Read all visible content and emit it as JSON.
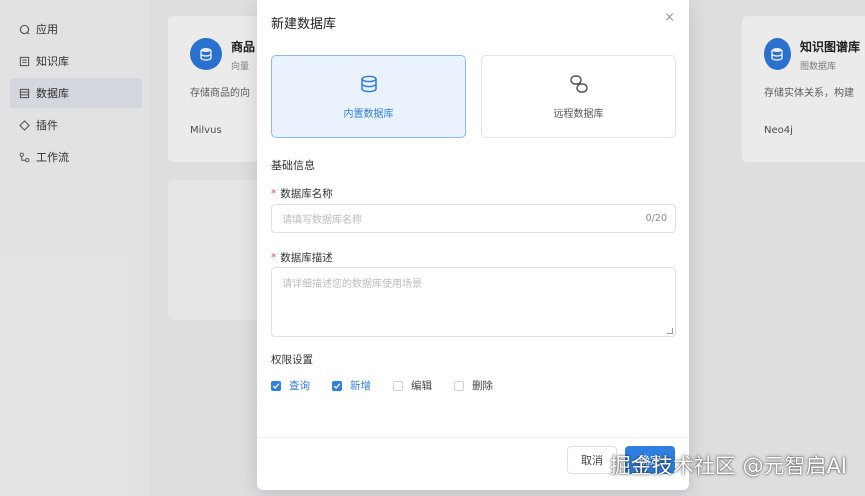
{
  "sidebar": {
    "items": [
      {
        "label": "应用",
        "icon": "app-icon"
      },
      {
        "label": "知识库",
        "icon": "book-icon"
      },
      {
        "label": "数据库",
        "icon": "database-icon",
        "active": true
      },
      {
        "label": "插件",
        "icon": "plugin-icon"
      },
      {
        "label": "工作流",
        "icon": "workflow-icon"
      }
    ]
  },
  "cards": [
    {
      "title": "商品",
      "subtitle": "向量",
      "desc": "存储商品的向",
      "engine": "Milvus"
    },
    {
      "title": "知识图谱库",
      "subtitle": "图数据库",
      "desc": "存储实体关系，构建",
      "engine": "Neo4j"
    }
  ],
  "modal": {
    "title": "新建数据库",
    "close": "×",
    "types": [
      {
        "label": "内置数据库",
        "icon": "database-icon",
        "active": true
      },
      {
        "label": "远程数据库",
        "icon": "link-icon",
        "active": false
      }
    ],
    "section_basic": "基础信息",
    "name_label": "数据库名称",
    "name_placeholder": "请填写数据库名称",
    "name_count": "0/20",
    "desc_label": "数据库描述",
    "desc_placeholder": "请详细描述您的数据库使用场景",
    "perm_title": "权限设置",
    "permissions": [
      {
        "label": "查询",
        "checked": true
      },
      {
        "label": "新增",
        "checked": true
      },
      {
        "label": "编辑",
        "checked": false
      },
      {
        "label": "删除",
        "checked": false
      }
    ],
    "cancel": "取消",
    "confirm": "确定"
  },
  "watermark": "掘金技术社区 @元智启AI",
  "colors": {
    "accent": "#2f7fe0",
    "required": "#e5484d"
  }
}
